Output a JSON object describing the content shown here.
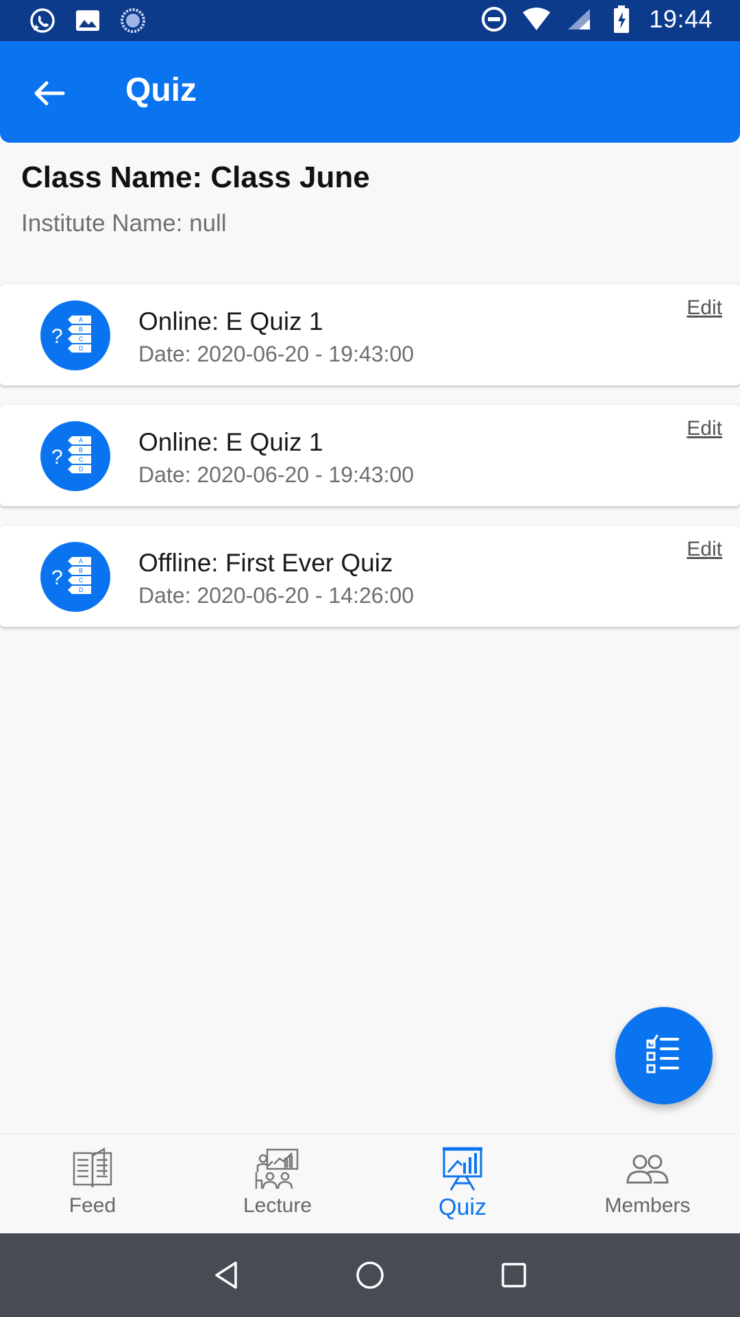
{
  "status_bar": {
    "time": "19:44",
    "left_icons": [
      "whatsapp-icon",
      "image-icon",
      "loader-icon"
    ],
    "right_icons": [
      "dnd-icon",
      "wifi-icon",
      "signal-icon",
      "battery-charging-icon"
    ]
  },
  "app_bar": {
    "title": "Quiz",
    "back_icon": "arrow-left-icon"
  },
  "header": {
    "class_name": "Class Name: Class June",
    "institute_name": "Institute Name: null"
  },
  "quizzes": [
    {
      "title": "Online: E Quiz 1",
      "date": "Date: 2020-06-20 - 19:43:00",
      "edit_label": "Edit"
    },
    {
      "title": "Online: E Quiz 1",
      "date": "Date: 2020-06-20 - 19:43:00",
      "edit_label": "Edit"
    },
    {
      "title": "Offline: First Ever Quiz",
      "date": "Date: 2020-06-20 - 14:26:00",
      "edit_label": "Edit"
    }
  ],
  "fab": {
    "icon": "checklist-icon"
  },
  "bottom_nav": {
    "items": [
      {
        "label": "Feed",
        "icon": "book-icon",
        "active": false
      },
      {
        "label": "Lecture",
        "icon": "classroom-icon",
        "active": false
      },
      {
        "label": "Quiz",
        "icon": "presentation-chart-icon",
        "active": true
      },
      {
        "label": "Members",
        "icon": "people-icon",
        "active": false
      }
    ]
  },
  "colors": {
    "primary": "#0a74f0",
    "status_bar": "#0d3b8c",
    "system_nav": "#474c54",
    "background": "#f8f8f8"
  }
}
